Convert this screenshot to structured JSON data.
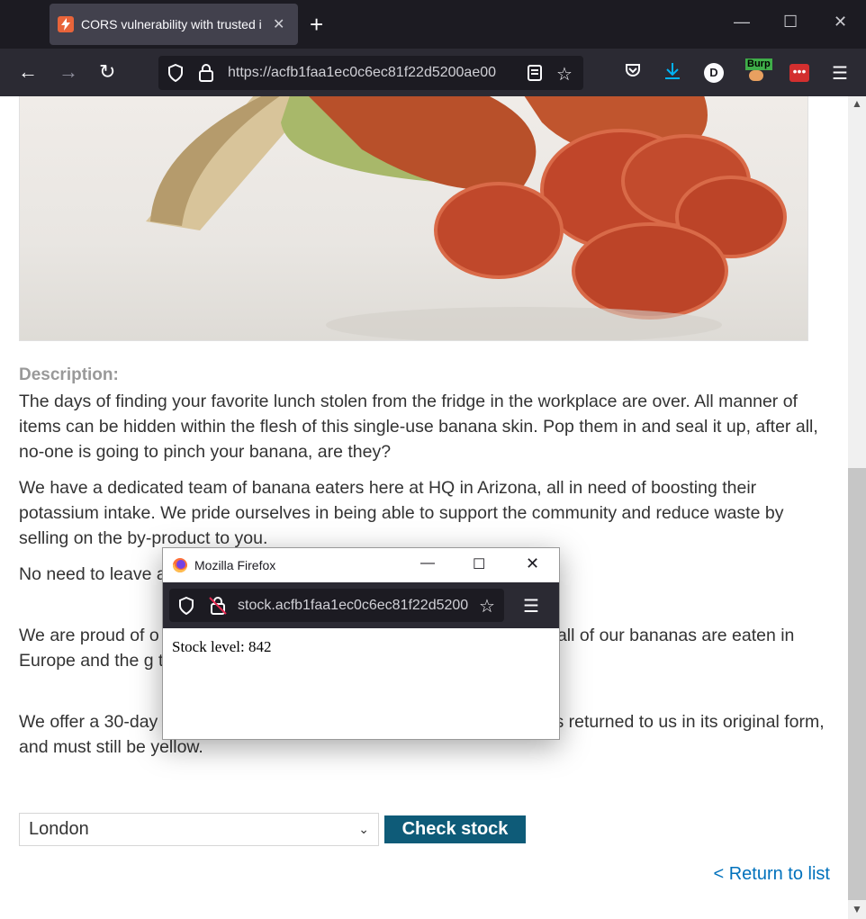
{
  "browser": {
    "tab_title": "CORS vulnerability with trusted i",
    "tab_close": "✕",
    "new_tab": "+",
    "url": "https://acfb1faa1ec0c6ec81f22d5200ae00",
    "window_controls": [
      "—",
      "☐",
      "✕"
    ],
    "extension_badge": "Burp",
    "profile_initial": "D"
  },
  "product": {
    "description_label": "Description:",
    "paragraphs": [
      "The days of finding your favorite lunch stolen from the fridge in the workplace are over. All manner of items can be hidden within the flesh of this single-use banana skin. Pop them in and seal it up, after all, no-one is going to pinch your banana, are they?",
      "We have a dedicated team of banana eaters here at HQ in Arizona, all in need of boosting their potassium intake. We pride ourselves in being able to support the community and reduce waste by selling on the by-product to you.",
      "No need to leave a to waste valuable resources by labeling all your fo",
      "We are proud of o number of small prizes for innovation, propell ntee all of our bananas are eaten in Europe and the g to convenience and peace of mind for all of our",
      "We offer a 30-day money back guarantee providing the banana skin is returned to us in its original form, and must still be yellow."
    ],
    "store_selected": "London",
    "check_stock_label": "Check stock",
    "return_link": "< Return to list"
  },
  "popup": {
    "window_title": "Mozilla Firefox",
    "url": "stock.acfb1faa1ec0c6ec81f22d5200",
    "body_text": "Stock level: 842"
  },
  "colors": {
    "accent_button": "#0e5b78",
    "link": "#0071bc",
    "browser_dark": "#2b2a33"
  }
}
